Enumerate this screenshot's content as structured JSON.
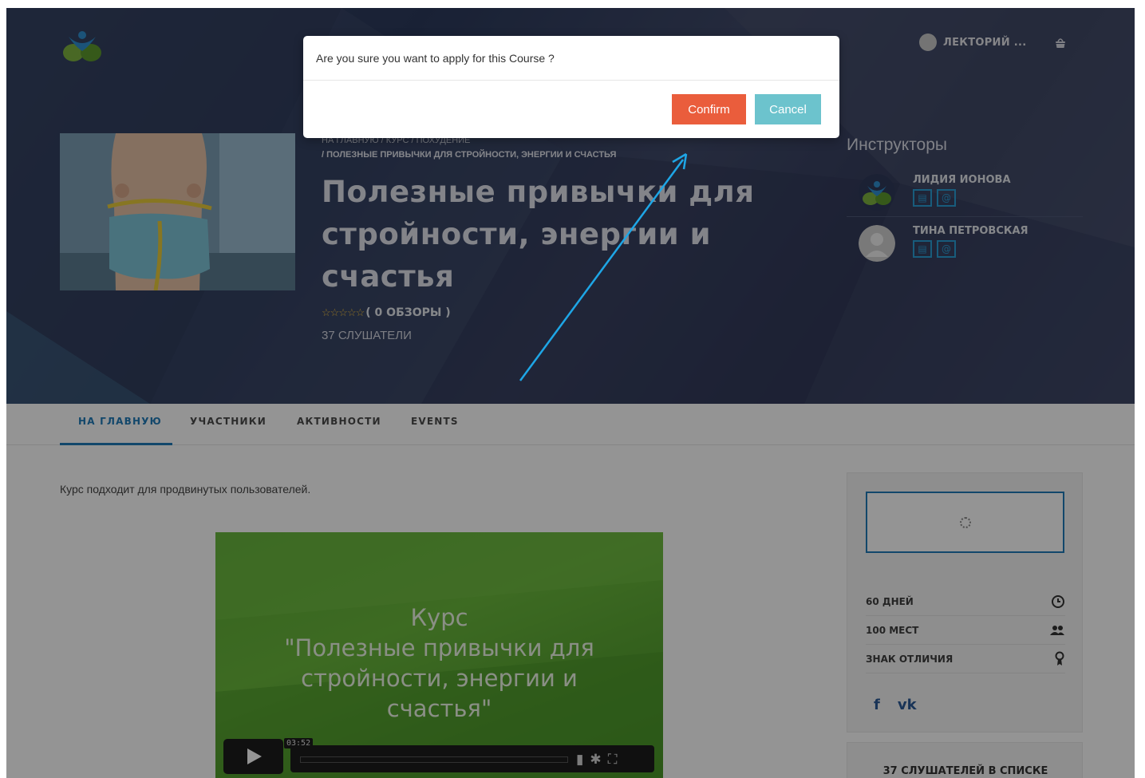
{
  "header": {
    "user_name": "ЛЕКТОРИЙ ...",
    "logo_icon": "person-leaves-logo",
    "cart_icon": "basket-icon"
  },
  "course": {
    "breadcrumb_line1": "НА ГЛАВНУЮ / КУРС / ПОХУДЕНИЕ",
    "breadcrumb_line2": "/ ПОЛЕЗНЫЕ ПРИВЫЧКИ ДЛЯ СТРОЙНОСТИ, ЭНЕРГИИ И СЧАСТЬЯ",
    "title": "Полезные привычки для стройности, энергии и счастья",
    "stars": "☆☆☆☆☆",
    "reviews": "( 0 ОБЗОРЫ )",
    "students": "37 СЛУШАТЕЛИ"
  },
  "instructors": {
    "title": "Инструкторы",
    "items": [
      {
        "name": "ЛИДИЯ ИОНОВА"
      },
      {
        "name": "ТИНА ПЕТРОВСКАЯ"
      }
    ]
  },
  "tabs": [
    {
      "label": "НА ГЛАВНУЮ"
    },
    {
      "label": "УЧАСТНИКИ"
    },
    {
      "label": "АКТИВНОСТИ"
    },
    {
      "label": "EVENTS"
    }
  ],
  "description": "Курс подходит для продвинутых пользователей.",
  "video": {
    "line1": "Курс",
    "line2": "\"Полезные привычки для",
    "line3": "стройности, энергии и",
    "line4": "счастья\"",
    "time": "03:52"
  },
  "sidebar": {
    "rows": [
      {
        "label": "60 ДНЕЙ",
        "icon": "clock-icon"
      },
      {
        "label": "100 МЕСТ",
        "icon": "users-icon"
      },
      {
        "label": "ЗНАК ОТЛИЧИЯ",
        "icon": "award-icon"
      }
    ],
    "social_f": "f",
    "social_vk": "vk",
    "students_list": "37 СЛУШАТЕЛЕЙ В СПИСКЕ"
  },
  "modal": {
    "message": "Are you sure you want to apply for this Course ?",
    "confirm": "Confirm",
    "cancel": "Cancel"
  },
  "colors": {
    "confirm": "#ea5d3c",
    "cancel": "#6cc3cd",
    "accent": "#1f7ab8",
    "arrow": "#1ea6e6"
  }
}
